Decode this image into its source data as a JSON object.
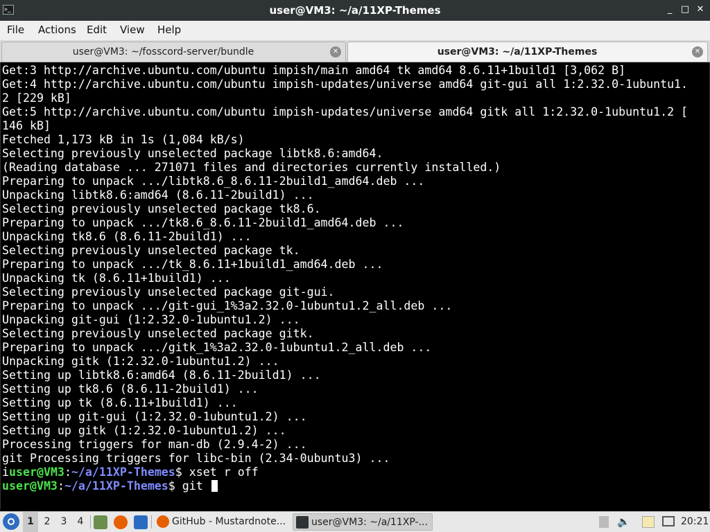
{
  "window": {
    "title": "user@VM3: ~/a/11XP-Themes",
    "minimize_glyph": "_",
    "maximize_glyph": "□",
    "close_glyph": "✕"
  },
  "menu": [
    "File",
    "Actions",
    "Edit",
    "View",
    "Help"
  ],
  "tabs": [
    {
      "label": "user@VM3: ~/fosscord-server/bundle",
      "close_glyph": "✕",
      "active": false
    },
    {
      "label": "user@VM3: ~/a/11XP-Themes",
      "close_glyph": "✕",
      "active": true
    }
  ],
  "terminal": {
    "lines": [
      "Get:3 http://archive.ubuntu.com/ubuntu impish/main amd64 tk amd64 8.6.11+1build1 [3,062 B]",
      "Get:4 http://archive.ubuntu.com/ubuntu impish-updates/universe amd64 git-gui all 1:2.32.0-1ubuntu1.",
      "2 [229 kB]",
      "Get:5 http://archive.ubuntu.com/ubuntu impish-updates/universe amd64 gitk all 1:2.32.0-1ubuntu1.2 [",
      "146 kB]",
      "Fetched 1,173 kB in 1s (1,084 kB/s)",
      "Selecting previously unselected package libtk8.6:amd64.",
      "(Reading database ... 271071 files and directories currently installed.)",
      "Preparing to unpack .../libtk8.6_8.6.11-2build1_amd64.deb ...",
      "Unpacking libtk8.6:amd64 (8.6.11-2build1) ...",
      "Selecting previously unselected package tk8.6.",
      "Preparing to unpack .../tk8.6_8.6.11-2build1_amd64.deb ...",
      "Unpacking tk8.6 (8.6.11-2build1) ...",
      "Selecting previously unselected package tk.",
      "Preparing to unpack .../tk_8.6.11+1build1_amd64.deb ...",
      "Unpacking tk (8.6.11+1build1) ...",
      "Selecting previously unselected package git-gui.",
      "Preparing to unpack .../git-gui_1%3a2.32.0-1ubuntu1.2_all.deb ...",
      "Unpacking git-gui (1:2.32.0-1ubuntu1.2) ...",
      "Selecting previously unselected package gitk.",
      "Preparing to unpack .../gitk_1%3a2.32.0-1ubuntu1.2_all.deb ...",
      "Unpacking gitk (1:2.32.0-1ubuntu1.2) ...",
      "Setting up libtk8.6:amd64 (8.6.11-2build1) ...",
      "Setting up tk8.6 (8.6.11-2build1) ...",
      "Setting up tk (8.6.11+1build1) ...",
      "Setting up git-gui (1:2.32.0-1ubuntu1.2) ...",
      "Setting up gitk (1:2.32.0-1ubuntu1.2) ...",
      "Processing triggers for man-db (2.9.4-2) ...",
      "git Processing triggers for libc-bin (2.34-0ubuntu3) ..."
    ],
    "prompt1": {
      "prefix": "i",
      "user": "user@VM3",
      "colon": ":",
      "path": "~/a/11XP-Themes",
      "symbol": "$ ",
      "command": "xset r off"
    },
    "prompt2": {
      "user": "user@VM3",
      "colon": ":",
      "path": "~/a/11XP-Themes",
      "symbol": "$ ",
      "command": "git "
    },
    "colors": {
      "background": "#000000",
      "text": "#ffffff",
      "user": "#4be24b",
      "path": "#7f8cff"
    }
  },
  "taskbar": {
    "workspaces": [
      "1",
      "2",
      "3",
      "4"
    ],
    "active_workspace": "1",
    "tasks": [
      {
        "label": "GitHub - Mustardnote...",
        "icon": "firefox-icon"
      },
      {
        "label": "user@VM3: ~/a/11XP-...",
        "icon": "terminal-icon"
      }
    ],
    "clock": "20:21"
  }
}
